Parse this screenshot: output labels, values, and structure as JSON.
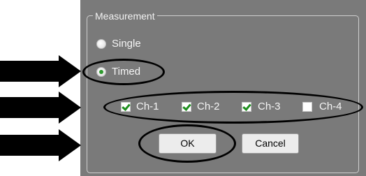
{
  "groupbox": {
    "title": "Measurement"
  },
  "radios": [
    {
      "label": "Single",
      "checked": false
    },
    {
      "label": "Timed",
      "checked": true
    }
  ],
  "channels": [
    {
      "label": "Ch-1",
      "checked": true
    },
    {
      "label": "Ch-2",
      "checked": true
    },
    {
      "label": "Ch-3",
      "checked": true
    },
    {
      "label": "Ch-4",
      "checked": false
    }
  ],
  "buttons": {
    "ok": "OK",
    "cancel": "Cancel"
  },
  "colors": {
    "panel": "#7a7a7a",
    "check_green": "#2e9a2e",
    "annotation": "#000000"
  },
  "annotations": {
    "arrow_count": 3,
    "ellipse_count": 3
  }
}
